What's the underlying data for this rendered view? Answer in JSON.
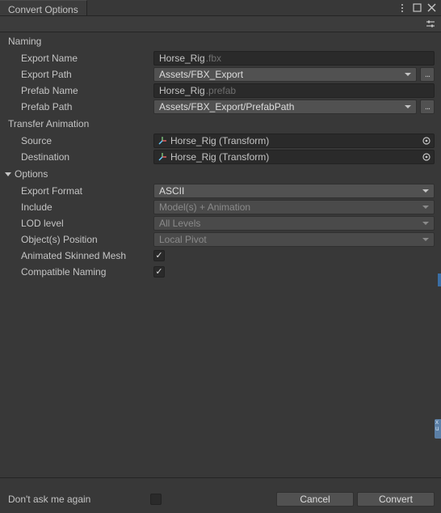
{
  "window": {
    "tab_title": "Convert Options"
  },
  "naming": {
    "header": "Naming",
    "export_name_label": "Export Name",
    "export_name_value": "Horse_Rig",
    "export_name_suffix": ".fbx",
    "export_path_label": "Export Path",
    "export_path_value": "Assets/FBX_Export",
    "browse": "...",
    "prefab_name_label": "Prefab Name",
    "prefab_name_value": "Horse_Rig",
    "prefab_name_suffix": ".prefab",
    "prefab_path_label": "Prefab Path",
    "prefab_path_value": "Assets/FBX_Export/PrefabPath"
  },
  "transfer": {
    "header": "Transfer Animation",
    "source_label": "Source",
    "source_value": "Horse_Rig (Transform)",
    "destination_label": "Destination",
    "destination_value": "Horse_Rig (Transform)"
  },
  "options": {
    "header": "Options",
    "export_format_label": "Export Format",
    "export_format_value": "ASCII",
    "include_label": "Include",
    "include_value": "Model(s) + Animation",
    "lod_label": "LOD level",
    "lod_value": "All Levels",
    "objpos_label": "Object(s) Position",
    "objpos_value": "Local Pivot",
    "anim_skinned_label": "Animated Skinned Mesh",
    "compat_naming_label": "Compatible Naming"
  },
  "footer": {
    "dont_ask_label": "Don't ask me again",
    "cancel": "Cancel",
    "convert": "Convert"
  }
}
